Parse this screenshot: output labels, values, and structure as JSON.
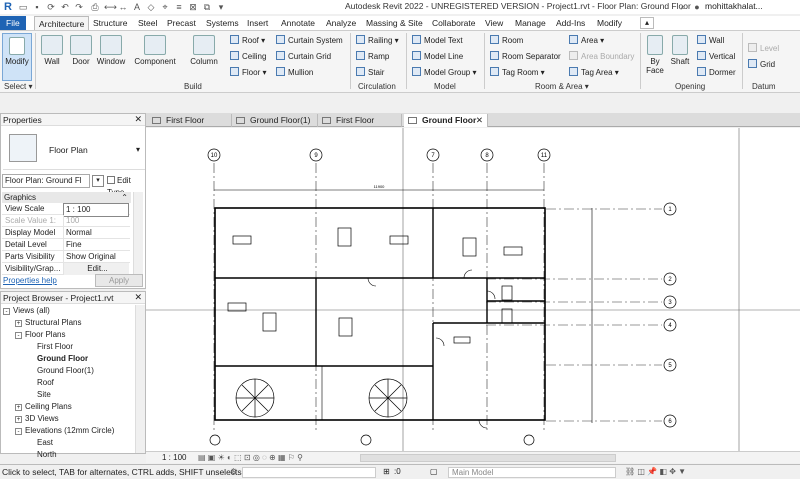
{
  "app": {
    "title": "Autodesk Revit 2022 - UNREGISTERED VERSION - Project1.rvt - Floor Plan: Ground Floor",
    "user": "mohittakhalat..."
  },
  "ribbon_tabs": [
    "File",
    "Architecture",
    "Structure",
    "Steel",
    "Precast",
    "Systems",
    "Insert",
    "Annotate",
    "Analyze",
    "Massing & Site",
    "Collaborate",
    "View",
    "Manage",
    "Add-Ins",
    "Modify"
  ],
  "ribbon": {
    "select": {
      "modify": "Modify",
      "label": "Select ▾"
    },
    "build": {
      "big": [
        "Wall",
        "Door",
        "Window",
        "Component",
        "Column"
      ],
      "small_col1": [
        "Roof ▾",
        "Ceiling",
        "Floor ▾"
      ],
      "small_col2": [
        "Curtain System",
        "Curtain Grid",
        "Mullion"
      ],
      "label": "Build"
    },
    "circulation": {
      "items": [
        "Railing ▾",
        "Ramp",
        "Stair"
      ],
      "label": "Circulation"
    },
    "model": {
      "items": [
        "Model Text",
        "Model Line",
        "Model Group ▾"
      ],
      "label": "Model"
    },
    "room_area": {
      "col1": [
        "Room",
        "Room Separator",
        "Tag Room ▾"
      ],
      "col2": [
        "Area ▾",
        "Area Boundary",
        "Tag Area ▾"
      ],
      "label": "Room & Area ▾"
    },
    "opening": {
      "big": [
        "By Face",
        "Shaft"
      ],
      "small": [
        "Wall",
        "Vertical",
        "Dormer"
      ],
      "label": "Opening"
    },
    "datum": {
      "items": [
        "Level",
        "Grid"
      ],
      "label": "Datum"
    }
  },
  "properties": {
    "title": "Properties",
    "type_name": "Floor Plan",
    "view_selector": "Floor Plan: Ground Fl",
    "edit_type": "Edit Type",
    "section": "Graphics",
    "rows": [
      {
        "key": "View Scale",
        "value": "1 : 100"
      },
      {
        "key": "Scale Value 1:",
        "value": "100"
      },
      {
        "key": "Display Model",
        "value": "Normal"
      },
      {
        "key": "Detail Level",
        "value": "Fine"
      },
      {
        "key": "Parts Visibility",
        "value": "Show Original"
      },
      {
        "key": "Visibility/Grap...",
        "value": "Edit..."
      }
    ],
    "help_link": "Properties help",
    "apply": "Apply"
  },
  "browser": {
    "title": "Project Browser - Project1.rvt",
    "items": [
      {
        "label": "Views (all)",
        "level": 0,
        "toggle": "-"
      },
      {
        "label": "Structural Plans",
        "level": 1,
        "toggle": "+"
      },
      {
        "label": "Floor Plans",
        "level": 1,
        "toggle": "-"
      },
      {
        "label": "First Floor",
        "level": 2,
        "toggle": ""
      },
      {
        "label": "Ground Floor",
        "level": 2,
        "toggle": "",
        "bold": true
      },
      {
        "label": "Ground Floor(1)",
        "level": 2,
        "toggle": ""
      },
      {
        "label": "Roof",
        "level": 2,
        "toggle": ""
      },
      {
        "label": "Site",
        "level": 2,
        "toggle": ""
      },
      {
        "label": "Ceiling Plans",
        "level": 1,
        "toggle": "+"
      },
      {
        "label": "3D Views",
        "level": 1,
        "toggle": "+"
      },
      {
        "label": "Elevations (12mm Circle)",
        "level": 1,
        "toggle": "-"
      },
      {
        "label": "East",
        "level": 2,
        "toggle": ""
      },
      {
        "label": "North",
        "level": 2,
        "toggle": ""
      }
    ]
  },
  "view_tabs": [
    "First Floor",
    "Ground Floor(1)",
    "First Floor",
    "Ground Floor"
  ],
  "grid_top": [
    "10",
    "9",
    "7",
    "8",
    "11"
  ],
  "grid_right": [
    "1",
    "2",
    "3",
    "4",
    "5",
    "6"
  ],
  "dimension_text": "11900",
  "view_bar": {
    "scale": "1 : 100"
  },
  "status": {
    "text": "Click to select, TAB for alternates, CTRL adds, SHIFT unselects.",
    "selection_count": ":0",
    "model": "Main Model"
  }
}
